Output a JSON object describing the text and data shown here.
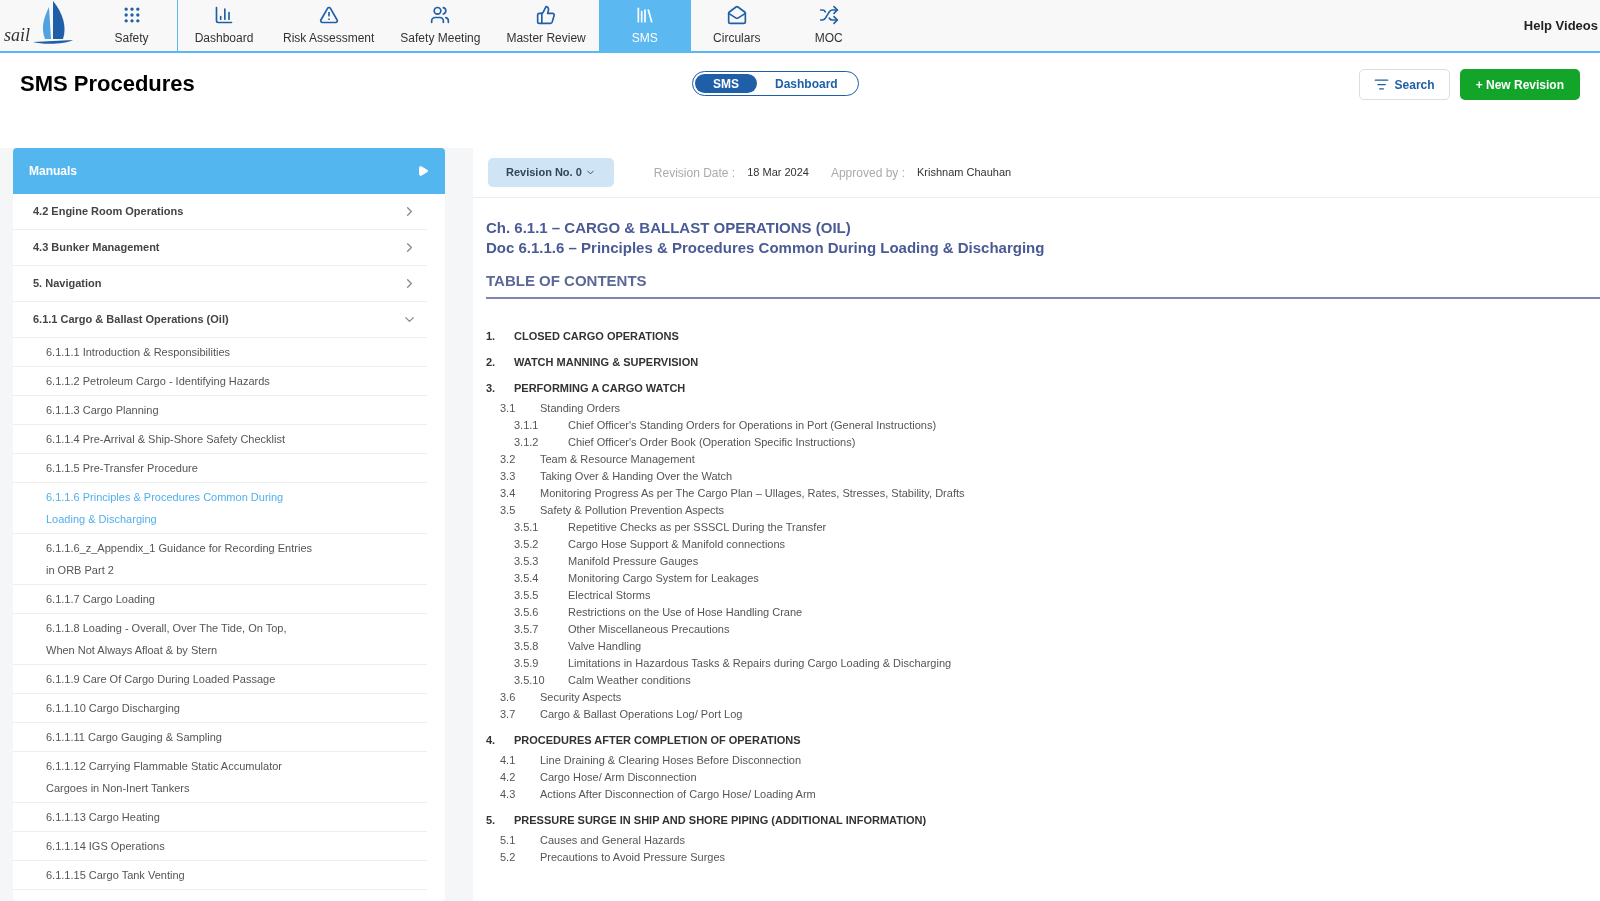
{
  "logo": {
    "text": "sail"
  },
  "nav": [
    {
      "label": "Safety",
      "selected": false
    },
    {
      "label": "Dashboard",
      "selected": false
    },
    {
      "label": "Risk Assessment",
      "selected": false
    },
    {
      "label": "Safety Meeting",
      "selected": false
    },
    {
      "label": "Master Review",
      "selected": false
    },
    {
      "label": "SMS",
      "selected": true
    },
    {
      "label": "Circulars",
      "selected": false
    },
    {
      "label": "MOC",
      "selected": false
    }
  ],
  "help": "Help Videos",
  "page_title": "SMS Procedures",
  "toggle": [
    {
      "label": "SMS",
      "selected": true
    },
    {
      "label": "Dashboard",
      "selected": false
    }
  ],
  "search_button": "Search",
  "new_button": "+ New Revision",
  "sidebar": {
    "title": "Manuals",
    "items": [
      {
        "label": "4.2 Engine Room Operations",
        "expanded": false
      },
      {
        "label": "4.3 Bunker Management",
        "expanded": false
      },
      {
        "label": "5. Navigation",
        "expanded": false
      },
      {
        "label": "6.1.1 Cargo & Ballast Operations (Oil)",
        "expanded": true,
        "children": [
          {
            "label": "6.1.1.1 Introduction & Responsibilities",
            "selected": false
          },
          {
            "label": "6.1.1.2 Petroleum Cargo - Identifying Hazards",
            "selected": false
          },
          {
            "label": "6.1.1.3 Cargo Planning",
            "selected": false
          },
          {
            "label": "6.1.1.4 Pre-Arrival & Ship-Shore Safety Checklist",
            "selected": false
          },
          {
            "label": "6.1.1.5 Pre-Transfer Procedure",
            "selected": false
          },
          {
            "label": "6.1.1.6 Principles & Procedures Common During Loading & Discharging",
            "selected": true
          },
          {
            "label": "6.1.1.6_z_Appendix_1 Guidance for Recording Entries in ORB Part 2",
            "selected": false
          },
          {
            "label": "6.1.1.7 Cargo Loading",
            "selected": false
          },
          {
            "label": "6.1.1.8 Loading - Overall, Over The Tide, On Top, When Not Always Afloat & by Stern",
            "selected": false
          },
          {
            "label": "6.1.1.9 Care Of Cargo During Loaded Passage",
            "selected": false
          },
          {
            "label": "6.1.1.10 Cargo Discharging",
            "selected": false
          },
          {
            "label": "6.1.1.11 Cargo Gauging & Sampling",
            "selected": false
          },
          {
            "label": "6.1.1.12 Carrying Flammable Static Accumulator Cargoes in Non-Inert Tankers",
            "selected": false
          },
          {
            "label": "6.1.1.13 Cargo Heating",
            "selected": false
          },
          {
            "label": "6.1.1.14 IGS Operations",
            "selected": false
          },
          {
            "label": "6.1.1.15 Cargo Tank Venting",
            "selected": false
          }
        ]
      }
    ]
  },
  "revision": {
    "select": "Revision No. 0",
    "date_label": "Revision Date :",
    "date": "18 Mar 2024",
    "approved_label": "Approved by :",
    "approved": "Krishnam Chauhan"
  },
  "doc": {
    "chapter": "Ch. 6.1.1 – CARGO & BALLAST OPERATIONS (OIL)",
    "title": "Doc 6.1.1.6 – Principles & Procedures Common During Loading & Discharging",
    "toc_heading": "TABLE OF CONTENTS",
    "toc": [
      {
        "num": "1.",
        "text": "CLOSED CARGO OPERATIONS"
      },
      {
        "num": "2.",
        "text": "WATCH MANNING & SUPERVISION"
      },
      {
        "num": "3.",
        "text": "PERFORMING A CARGO WATCH",
        "children": [
          {
            "num": "3.1",
            "text": "Standing Orders",
            "children": [
              {
                "num": "3.1.1",
                "text": "Chief Officer's Standing Orders for Operations in Port (General Instructions)"
              },
              {
                "num": "3.1.2",
                "text": "Chief Officer's Order Book (Operation Specific Instructions)"
              }
            ]
          },
          {
            "num": "3.2",
            "text": "Team & Resource Management"
          },
          {
            "num": "3.3",
            "text": "Taking Over & Handing Over the Watch"
          },
          {
            "num": "3.4",
            "text": "Monitoring Progress As per The Cargo Plan – Ullages, Rates, Stresses, Stability, Drafts"
          },
          {
            "num": "3.5",
            "text": "Safety & Pollution Prevention Aspects",
            "children": [
              {
                "num": "3.5.1",
                "text": "Repetitive Checks as per SSSCL During the Transfer"
              },
              {
                "num": "3.5.2",
                "text": "Cargo Hose Support & Manifold connections"
              },
              {
                "num": "3.5.3",
                "text": "Manifold Pressure Gauges"
              },
              {
                "num": "3.5.4",
                "text": "Monitoring Cargo System for Leakages"
              },
              {
                "num": "3.5.5",
                "text": "Electrical Storms"
              },
              {
                "num": "3.5.6",
                "text": "Restrictions on the Use of Hose Handling Crane"
              },
              {
                "num": "3.5.7",
                "text": "Other Miscellaneous Precautions"
              },
              {
                "num": "3.5.8",
                "text": "Valve Handling"
              },
              {
                "num": "3.5.9",
                "text": "Limitations in Hazardous Tasks & Repairs during Cargo Loading & Discharging"
              },
              {
                "num": "3.5.10",
                "text": "Calm Weather conditions"
              }
            ]
          },
          {
            "num": "3.6",
            "text": "Security Aspects"
          },
          {
            "num": "3.7",
            "text": "Cargo & Ballast Operations Log/ Port Log"
          }
        ]
      },
      {
        "num": "4.",
        "text": "PROCEDURES AFTER COMPLETION OF OPERATIONS",
        "children": [
          {
            "num": "4.1",
            "text": "Line Draining & Clearing Hoses Before Disconnection"
          },
          {
            "num": "4.2",
            "text": "Cargo Hose/ Arm Disconnection"
          },
          {
            "num": "4.3",
            "text": "Actions After Disconnection of Cargo Hose/ Loading Arm"
          }
        ]
      },
      {
        "num": "5.",
        "text": "PRESSURE SURGE IN SHIP AND SHORE PIPING (ADDITIONAL INFORMATION)",
        "children": [
          {
            "num": "5.1",
            "text": "Causes and General Hazards"
          },
          {
            "num": "5.2",
            "text": "Precautions to Avoid Pressure Surges"
          }
        ]
      }
    ]
  }
}
